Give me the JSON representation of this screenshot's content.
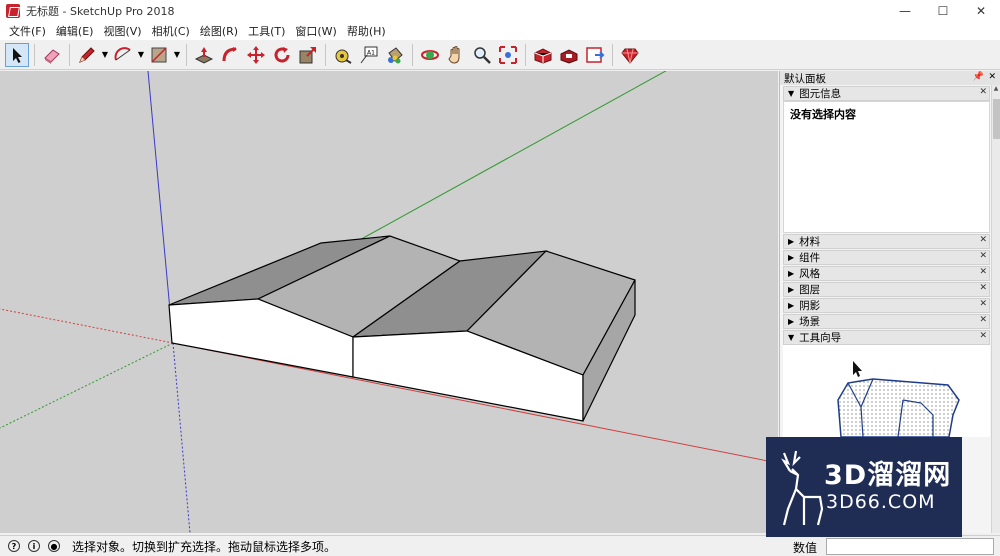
{
  "window": {
    "title": "无标题 - SketchUp Pro 2018",
    "minimize": "—",
    "maximize": "☐",
    "close": "✕"
  },
  "menu": [
    "文件(F)",
    "编辑(E)",
    "视图(V)",
    "相机(C)",
    "绘图(R)",
    "工具(T)",
    "窗口(W)",
    "帮助(H)"
  ],
  "toolbar": {
    "items": [
      "select-tool-icon",
      "eraser-tool-icon",
      "pencil-tool-icon",
      "arc-tool-icon",
      "rectangle-tool-icon",
      "push-pull-icon",
      "follow-me-icon",
      "move-icon",
      "rotate-icon",
      "scale-icon",
      "tape-measure-icon",
      "text-icon",
      "paint-bucket-icon",
      "orbit-icon",
      "pan-icon",
      "zoom-icon",
      "zoom-extents-icon",
      "3d-warehouse-icon",
      "extension-warehouse-icon",
      "layout-icon",
      "ruby-icon"
    ]
  },
  "tray": {
    "title": "默认面板",
    "entity_info": {
      "title": "图元信息",
      "content": "没有选择内容"
    },
    "panels": [
      "材料",
      "组件",
      "风格",
      "图层",
      "阴影",
      "场景"
    ],
    "instructor": {
      "title": "工具向导"
    }
  },
  "status": {
    "text": "选择对象。切换到扩充选择。拖动鼠标选择多项。",
    "vcb_label": "数值",
    "vcb_value": ""
  },
  "watermark": {
    "main": "3D溜溜网",
    "sub": "3D66.COM"
  },
  "colors": {
    "viewport_bg": "#cfcfcf",
    "accent": "#c8232c",
    "axis_red": "#d04040",
    "axis_green": "#2e9a2e",
    "axis_blue": "#3a3ac8",
    "watermark_bg": "#1f2d55"
  }
}
